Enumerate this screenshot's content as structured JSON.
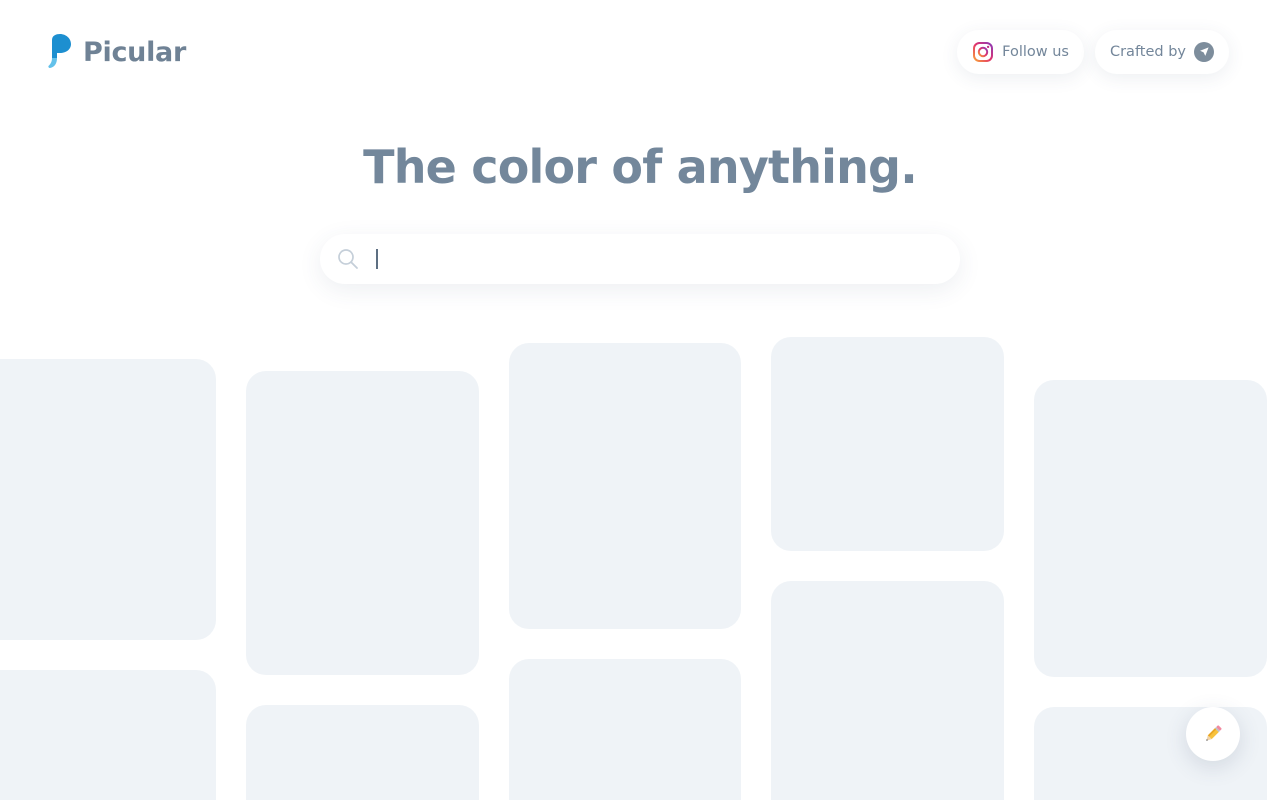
{
  "brand": {
    "name": "Picular",
    "colors": {
      "logo_dark": "#1d8fd0",
      "logo_light": "#63c1ea",
      "text": "#6f8295"
    }
  },
  "header": {
    "follow": {
      "label": "Follow us",
      "icon": "instagram-icon"
    },
    "crafted": {
      "label": "Crafted by",
      "icon": "compass-icon"
    }
  },
  "hero": {
    "headline": "The color of anything.",
    "search": {
      "value": "",
      "placeholder": "",
      "icon": "search-icon"
    }
  },
  "results": {
    "state": "loading",
    "placeholder_color": "#eff3f7",
    "columns": 5,
    "cards_visible": 10
  },
  "fab": {
    "icon": "pencil-icon"
  }
}
